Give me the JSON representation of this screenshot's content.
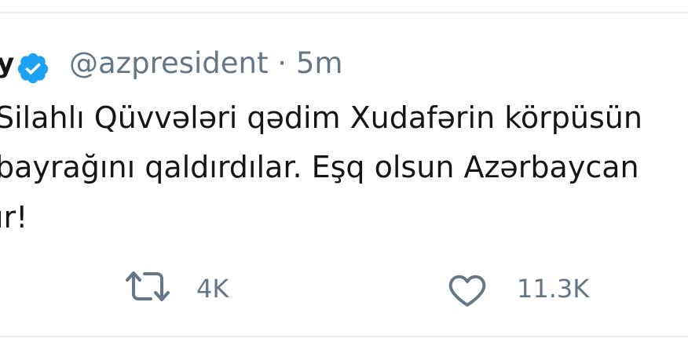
{
  "tweet": {
    "author_name_fragment": "y",
    "handle": "@azpresident",
    "separator": "·",
    "time": "5m",
    "lines": [
      "Silahlı Qüvvələri qədim Xudafərin körpüsün",
      "bayrağını qaldırdılar. Eşq olsun Azərbaycan",
      "ır!"
    ],
    "retweet_count": "4K",
    "like_count": "11.3K"
  },
  "colors": {
    "verified_badge": "#1da1f2",
    "secondary_text": "#657786",
    "primary_text": "#14171a",
    "divider": "#e6ecf0"
  },
  "icons": [
    "verified-badge-icon",
    "retweet-icon",
    "like-heart-icon"
  ]
}
